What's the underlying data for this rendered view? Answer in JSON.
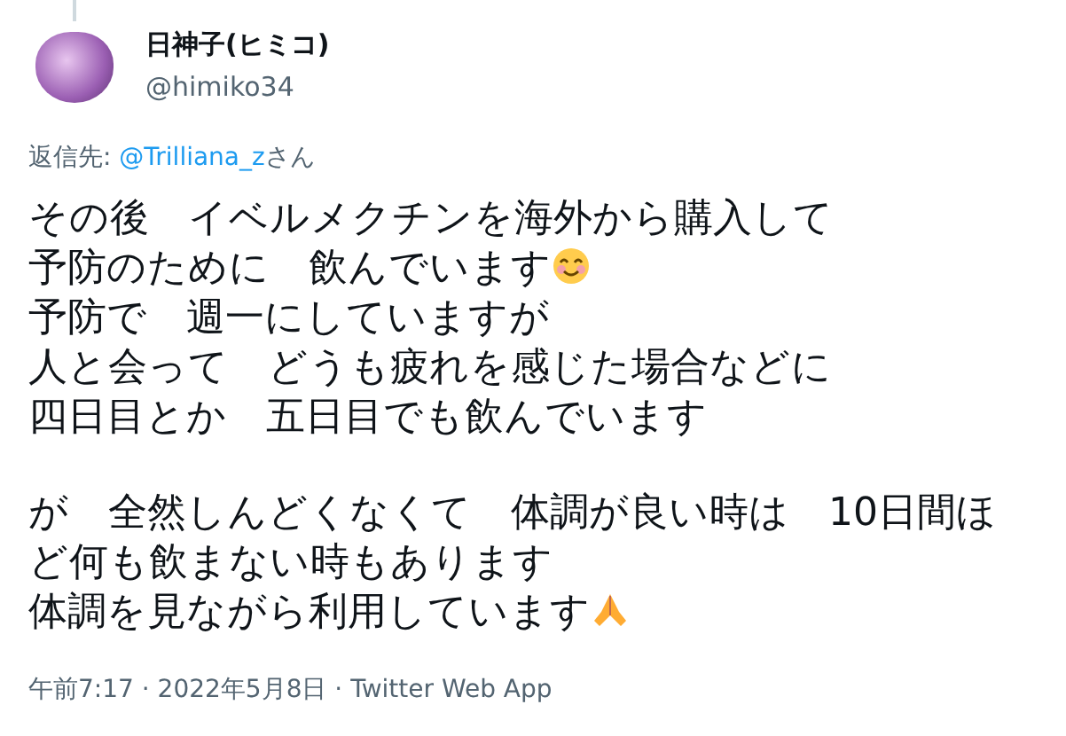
{
  "author": {
    "name": "日神子(ヒミコ)",
    "handle": "@himiko34"
  },
  "reply_to": {
    "label": "返信先:",
    "mention": "@Trilliana_z",
    "suffix": "さん"
  },
  "paragraphs": [
    [
      {
        "text": "その後　イベルメクチンを海外から購入して"
      },
      {
        "text": "予防のために　飲んでいます",
        "kind": "smile"
      },
      {
        "text": "予防で　週一にしていますが"
      },
      {
        "text": "人と会って　どうも疲れを感じた場合などに"
      },
      {
        "text": "四日目とか　五日目でも飲んでいます"
      }
    ],
    [
      {
        "text": "が　全然しんどくなくて　体調が良い時は　10日間ほ"
      },
      {
        "text": "ど何も飲まない時もあります"
      },
      {
        "text": "体調を見ながら利用しています",
        "kind": "pray"
      }
    ]
  ],
  "footer": {
    "text": "午前7:17 · 2022年5月8日 · Twitter Web App"
  }
}
